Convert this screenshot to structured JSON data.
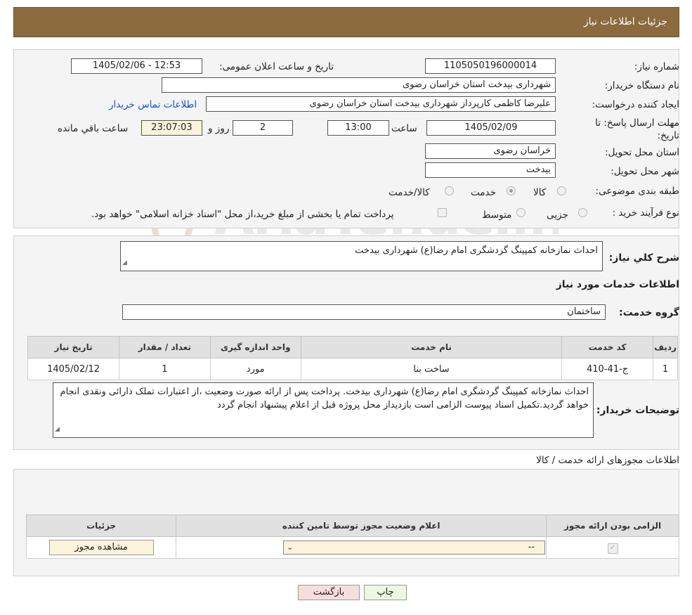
{
  "header": {
    "title": "جزئیات اطلاعات نیاز"
  },
  "form": {
    "need_number_label": "شماره نیاز:",
    "need_number": "1105050196000014",
    "announce_label": "تاریخ و ساعت اعلان عمومی:",
    "announce_value": "1405/02/06 - 12:53",
    "buyer_org_label": "نام دستگاه خریدار:",
    "buyer_org": "شهرداری بیدخت استان خراسان رضوی",
    "creator_label": "ایجاد کننده درخواست:",
    "creator": "علیرضا کاظمی کارپرداز شهرداری بیدخت استان خراسان رضوی",
    "contact_link": "اطلاعات تماس خریدار",
    "deadline_label": "مهلت ارسال پاسخ: تا تاریخ:",
    "deadline_date": "1405/02/09",
    "time_label": "ساعت",
    "deadline_time": "13:00",
    "days_value": "2",
    "days_label": "روز و",
    "remaining_time": "23:07:03",
    "remaining_label": "ساعت باقي مانده",
    "province_label": "استان محل تحویل:",
    "province": "خراسان رضوی",
    "city_label": "شهر محل تحویل:",
    "city": "بیدخت",
    "category_label": "طبقه بندی موضوعی:",
    "category_options": [
      "کالا",
      "خدمت",
      "کالا/خدمت"
    ],
    "category_selected": "خدمت",
    "process_label": "نوع فرآیند خرید :",
    "process_options": [
      "جزیی",
      "متوسط"
    ],
    "process_note": "پرداخت تمام یا بخشی از مبلغ خرید،از محل \"اسناد خزانه اسلامی\" خواهد بود."
  },
  "description": {
    "label": "شرح کلي نياز:",
    "value": "احداث نمازخانه کمپینگ گردشگری امام رضا(ع) شهرداری بیدخت"
  },
  "services": {
    "section_title": "اطلاعات خدمات مورد نياز",
    "group_label": "گروه خدمت:",
    "group_value": "ساختمان",
    "columns": [
      "رديف",
      "کد خدمت",
      "نام خدمت",
      "واحد اندازه گيری",
      "تعداد / مقدار",
      "تاريخ نياز"
    ],
    "rows": [
      {
        "row": "1",
        "code": "ج-41-410",
        "name": "ساخت بنا",
        "unit": "مورد",
        "qty": "1",
        "date": "1405/02/12"
      }
    ]
  },
  "buyer_notes": {
    "label": "توضيحات خريدار:",
    "value": "احداث نمازخانه کمپینگ گردشگری امام رضا(ع) شهرداری بیدخت. پرداخت پس از ارائه صورت وضعیت ،از اعتبارات تملک دارائی ونقدی انجام خواهد گردید.تکمیل اسناد پیوست الزامی است بازدیداز محل پروژه قبل از اعلام پیشنهاد انجام گردد"
  },
  "permits": {
    "section_title": "اطلاعات مجوزهای ارائه خدمت / کالا",
    "columns": [
      "الزامی بودن ارائه مجوز",
      "اعلام وضعیت مجوز توسط تامین کننده",
      "جزئیات"
    ],
    "select_value": "--",
    "view_button": "مشاهده مجوز"
  },
  "actions": {
    "print": "چاپ",
    "back": "بازگشت"
  },
  "colors": {
    "header": "#8b6a3d",
    "link": "#1a4fd6",
    "back_button": "#f7dede",
    "print_button": "#eef7e0"
  }
}
